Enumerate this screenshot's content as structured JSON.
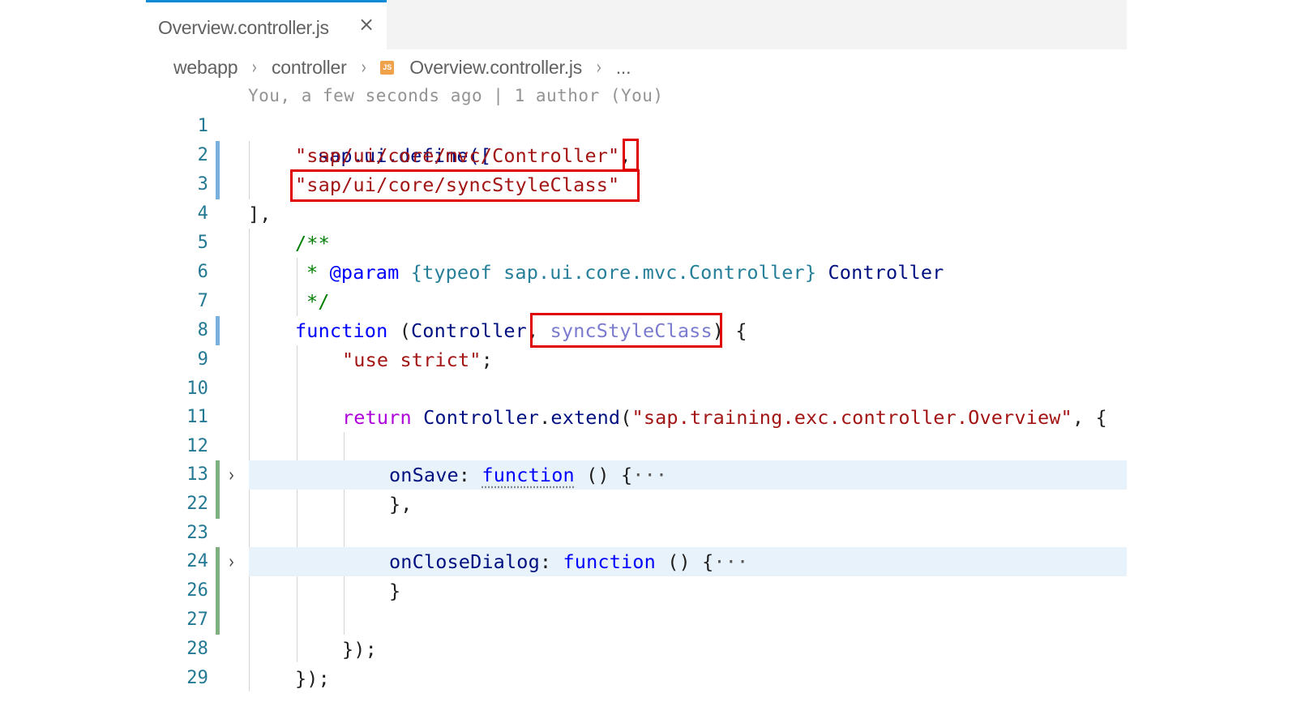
{
  "tab": {
    "filename": "Overview.controller.js",
    "close_icon": "close-icon"
  },
  "breadcrumb": {
    "items": [
      "webapp",
      "controller",
      "Overview.controller.js",
      "..."
    ],
    "file_icon_label": "JS"
  },
  "blame": "You, a few seconds ago | 1 author (You)",
  "colors": {
    "modified_gutter": "#7ab0de",
    "added_gutter": "#7fb080",
    "highlight_box": "#e00000",
    "folded_line_bg": "#e8f2fb"
  },
  "lines": [
    {
      "n": "1",
      "t": [
        "sap.ui.define(["
      ]
    },
    {
      "n": "2",
      "t": [
        "\"sap/ui/core/mvc/Controller\"",
        ","
      ]
    },
    {
      "n": "3",
      "t": [
        "\"sap/ui/core/syncStyleClass\""
      ]
    },
    {
      "n": "4",
      "t": [
        "],"
      ]
    },
    {
      "n": "5",
      "t": [
        "/**"
      ]
    },
    {
      "n": "6",
      "t": [
        "* ",
        "@param",
        " ",
        "{typeof sap.ui.core.mvc.Controller}",
        " ",
        "Controller"
      ]
    },
    {
      "n": "7",
      "t": [
        "*/"
      ]
    },
    {
      "n": "8",
      "t": [
        "function",
        " (",
        "Controller",
        ", ",
        "syncStyleClass",
        ") {"
      ]
    },
    {
      "n": "9",
      "t": [
        "\"use strict\"",
        ";"
      ]
    },
    {
      "n": "10",
      "t": []
    },
    {
      "n": "11",
      "t": [
        "return",
        " ",
        "Controller",
        ".",
        "extend",
        "(",
        "\"sap.training.exc.controller.Overview\"",
        ", {"
      ]
    },
    {
      "n": "12",
      "t": []
    },
    {
      "n": "13",
      "t": [
        "onSave",
        ": ",
        "function",
        " () {",
        "···"
      ]
    },
    {
      "n": "22",
      "t": [
        "},"
      ]
    },
    {
      "n": "23",
      "t": []
    },
    {
      "n": "24",
      "t": [
        "onCloseDialog",
        ": ",
        "function",
        " () {",
        "···"
      ]
    },
    {
      "n": "26",
      "t": [
        "}"
      ]
    },
    {
      "n": "27",
      "t": []
    },
    {
      "n": "28",
      "t": [
        "});"
      ]
    },
    {
      "n": "29",
      "t": [
        "});"
      ]
    }
  ]
}
